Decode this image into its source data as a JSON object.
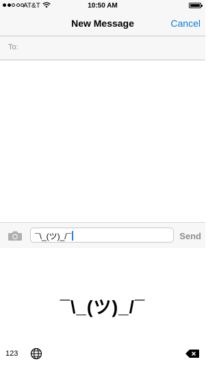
{
  "status_bar": {
    "carrier": "AT&T",
    "time": "10:50 AM",
    "signal_bars_filled": 2,
    "signal_bars_total": 5,
    "battery_level": 1.0
  },
  "nav_bar": {
    "title": "New Message",
    "cancel_label": "Cancel"
  },
  "recipient": {
    "label": "To:",
    "value": ""
  },
  "compose": {
    "text": "¯\\_(ツ)_/¯",
    "send_label": "Send"
  },
  "keyboard": {
    "emoticon": "¯\\_(ツ)_/¯",
    "numbers_key": "123"
  },
  "colors": {
    "accent": "#0b7bd6",
    "disabled": "#8e8e93",
    "bar_background": "#f7f7f7"
  },
  "icons": [
    "wifi-icon",
    "battery-icon",
    "camera-icon",
    "globe-icon",
    "delete-icon"
  ]
}
